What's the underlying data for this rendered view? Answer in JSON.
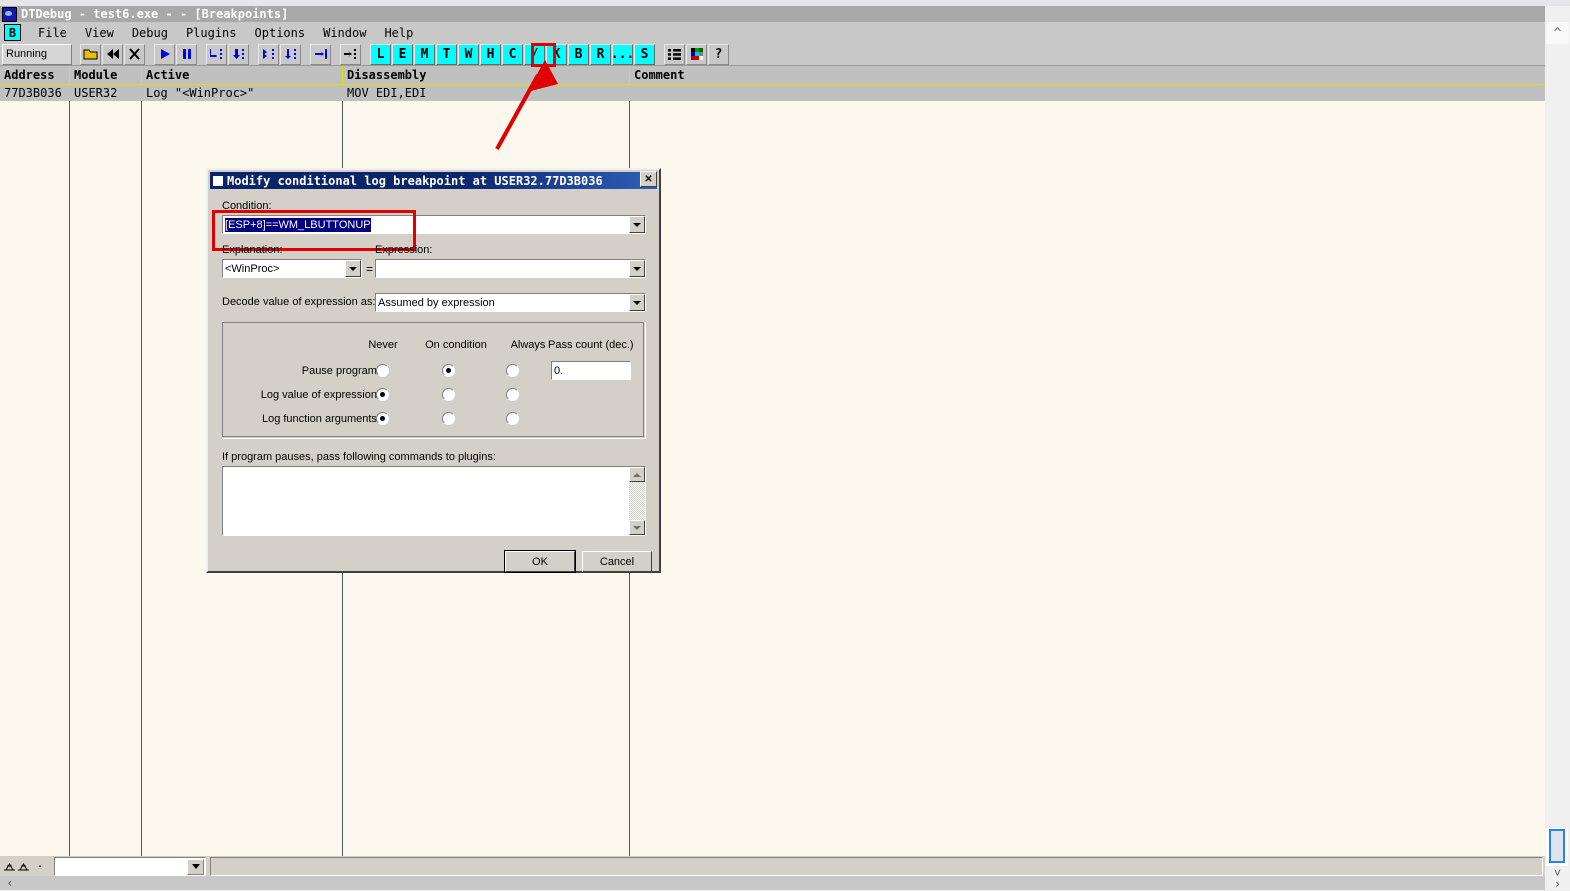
{
  "window": {
    "title": "DTDebug - test6.exe - - [Breakpoints]",
    "icon": "app-icon"
  },
  "menubar": {
    "icon_label": "B",
    "items": [
      "File",
      "View",
      "Debug",
      "Plugins",
      "Options",
      "Window",
      "Help"
    ]
  },
  "toolbar": {
    "status_label": "Running",
    "icon_buttons": [
      {
        "name": "open-folder-icon",
        "title": "Open"
      },
      {
        "name": "restart-icon",
        "title": "Restart"
      },
      {
        "name": "close-icon",
        "title": "Close"
      },
      {
        "name": "run-icon",
        "title": "Run"
      },
      {
        "name": "pause-icon",
        "title": "Pause"
      },
      {
        "name": "step-into-icon",
        "title": "Step into"
      },
      {
        "name": "step-over-icon",
        "title": "Step over"
      },
      {
        "name": "animate-into-icon",
        "title": "Animate into"
      },
      {
        "name": "animate-over-icon",
        "title": "Animate over"
      },
      {
        "name": "execute-till-return-icon",
        "title": "Execute till return"
      },
      {
        "name": "trace-icon",
        "title": "Trace"
      }
    ],
    "letter_buttons": [
      "L",
      "E",
      "M",
      "T",
      "W",
      "H",
      "C",
      "/",
      "K",
      "B",
      "R",
      "...",
      "S"
    ],
    "active_letter": "B",
    "extra_buttons": [
      {
        "name": "list-view-icon"
      },
      {
        "name": "color-palette-icon"
      },
      {
        "name": "help-question-icon",
        "label": "?"
      }
    ]
  },
  "table": {
    "columns": [
      "Address",
      "Module",
      "Active",
      "Disassembly",
      "Comment"
    ],
    "rows": [
      {
        "address": "77D3B036",
        "module": "USER32",
        "active": "Log \"<WinProc>\"",
        "disassembly": "MOV EDI,EDI",
        "comment": ""
      }
    ]
  },
  "dialog": {
    "title": "Modify conditional log breakpoint at USER32.77D3B036",
    "close_label": "✕",
    "condition": {
      "label": "Condition:",
      "value": "[ESP+8]==WM_LBUTTONUP",
      "selected": true
    },
    "explanation": {
      "label": "Explanation:",
      "value": "<WinProc>"
    },
    "equals_sign": "=",
    "expression": {
      "label": "Expression:",
      "value": "",
      "placeholder": ""
    },
    "decode": {
      "label": "Decode value of expression as:",
      "value": "Assumed by expression"
    },
    "matrix": {
      "column_headers": [
        "Never",
        "On condition",
        "Always",
        "Pass count (dec.)"
      ],
      "rows": [
        {
          "label": "Pause program:",
          "selected": "On condition"
        },
        {
          "label": "Log value of expression:",
          "selected": "Never"
        },
        {
          "label": "Log function arguments:",
          "selected": "Never"
        }
      ],
      "pass_count_value": "0."
    },
    "plugins": {
      "label": "If program pauses, pass following commands to plugins:",
      "value": ""
    },
    "buttons": {
      "ok": "OK",
      "cancel": "Cancel"
    }
  },
  "annotations": {
    "arrow_color": "#E00000",
    "highlight_color": "#E00000"
  },
  "statusbar": {
    "combo_value": "",
    "right_value": ""
  },
  "colors": {
    "desktop": "#ECECEC",
    "list_background": "#FDF8EE",
    "header_background": "#C0C0C0",
    "grid_line": "#E0E000",
    "toolbar_accent": "#00FFFF",
    "dialog_face": "#D4D0C8",
    "titlebar": "#0A246A",
    "selection": "#000080"
  }
}
